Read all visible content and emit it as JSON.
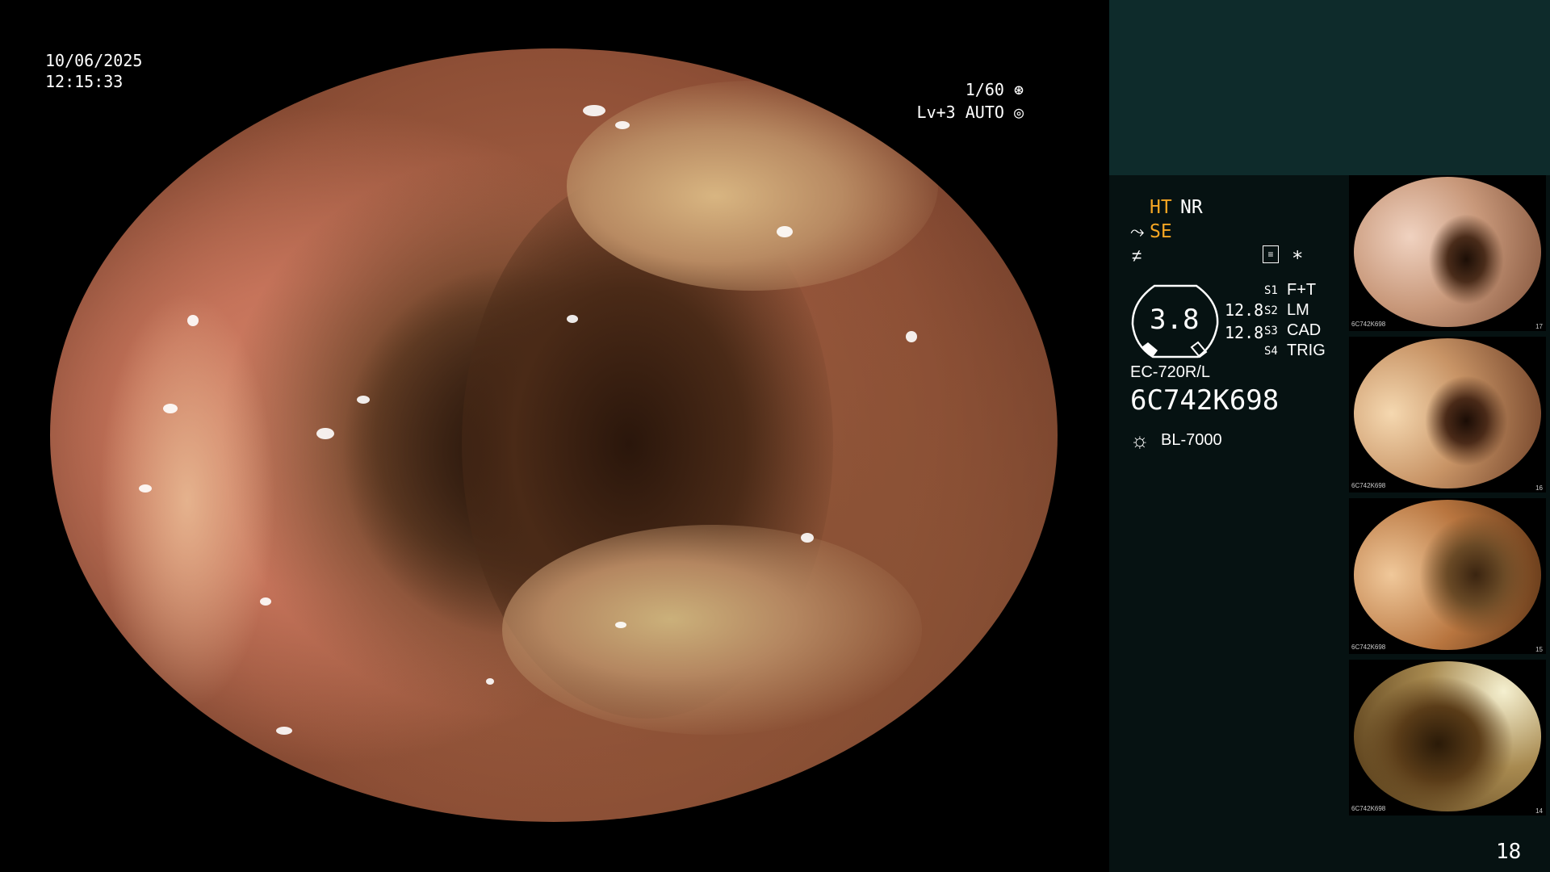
{
  "overlay": {
    "date": "10/06/2025",
    "time": "12:15:33",
    "shutter": "1/60",
    "shutter_icon": "aperture-icon",
    "level": "Lv+3 AUTO",
    "level_icon": "auto-iris-icon"
  },
  "panel": {
    "ht_label": "HT",
    "nr_label": "NR",
    "se_label": "SE",
    "se_icon": "structure-enhance-icon",
    "f_icon": "f-symbol-icon",
    "settings_icon": "settings-list-icon",
    "asterisk": "*",
    "gauge_value": "3.8",
    "gauge_right_top": "12.8",
    "gauge_right_bottom": "12.8",
    "switches": [
      {
        "key": "S1",
        "value": "F+T"
      },
      {
        "key": "S2",
        "value": "LM"
      },
      {
        "key": "S3",
        "value": "CAD"
      },
      {
        "key": "S4",
        "value": "TRIG"
      }
    ],
    "scope_model": "EC-720R/L",
    "serial": "6C742K698",
    "light_source_icon": "light-source-icon",
    "light_source": "BL-7000",
    "frame_count": "18"
  },
  "thumbnails": [
    {
      "num": "17",
      "id": "6C742K698"
    },
    {
      "num": "16",
      "id": "6C742K698"
    },
    {
      "num": "15",
      "id": "6C742K698"
    },
    {
      "num": "14",
      "id": "6C742K698"
    }
  ],
  "colors": {
    "panel_bg": "#061212",
    "panel_top_bg": "#0e2b2b",
    "accent_orange": "#f5a623"
  }
}
